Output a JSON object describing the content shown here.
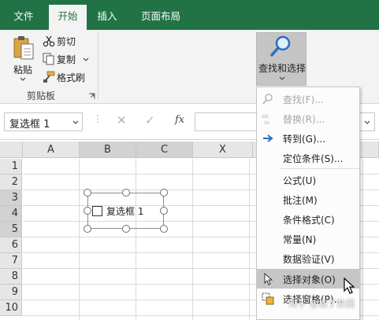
{
  "tabs": [
    "文件",
    "开始",
    "插入",
    "页面布局"
  ],
  "clipboard": {
    "paste_label": "粘贴",
    "cut_label": "剪切",
    "copy_label": "复制",
    "format_painter_label": "格式刷",
    "group_label": "剪贴板"
  },
  "find_select": {
    "label": "查找和选择"
  },
  "formula_bar": {
    "name_box_value": "复选框 1",
    "fx_label": "fx",
    "formula_value": ""
  },
  "grid": {
    "columns": [
      "A",
      "B",
      "C",
      "X"
    ],
    "rows": [
      "1",
      "2",
      "3",
      "4",
      "5",
      "6",
      "7",
      "8",
      "9",
      "10"
    ]
  },
  "checkbox": {
    "label": "复选框 1",
    "checked": false
  },
  "menu": {
    "items": [
      {
        "label": "查找(F)...",
        "enabled": false,
        "icon": "search-icon"
      },
      {
        "label": "替换(R)...",
        "enabled": false,
        "icon": "replace-icon"
      },
      {
        "label": "转到(G)...",
        "enabled": true,
        "icon": "arrow-right-icon"
      },
      {
        "label": "定位条件(S)...",
        "enabled": true,
        "icon": ""
      },
      {
        "label": "公式(U)",
        "enabled": true,
        "icon": ""
      },
      {
        "label": "批注(M)",
        "enabled": true,
        "icon": ""
      },
      {
        "label": "条件格式(C)",
        "enabled": true,
        "icon": ""
      },
      {
        "label": "常量(N)",
        "enabled": true,
        "icon": ""
      },
      {
        "label": "数据验证(V)",
        "enabled": true,
        "icon": ""
      },
      {
        "label": "选择对象(O)",
        "enabled": true,
        "icon": "pointer-icon",
        "highlighted": true
      },
      {
        "label": "选择窗格(P)...",
        "enabled": true,
        "icon": "selection-pane-icon"
      }
    ]
  },
  "watermark": "知乎 @加丁数据",
  "colors": {
    "brand": "#217346",
    "ribbon_bg": "#f3f3f3",
    "menu_highlight": "#c6c6c6"
  }
}
